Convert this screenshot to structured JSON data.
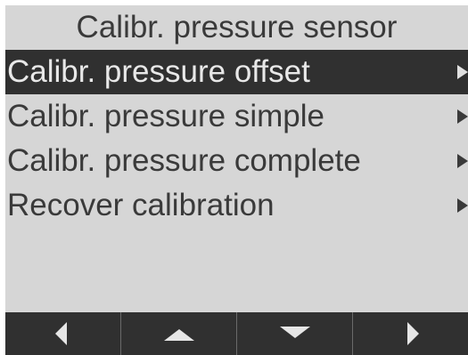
{
  "screen": {
    "title": "Calibr. pressure sensor"
  },
  "menu": {
    "items": [
      {
        "label": "Calibr. pressure offset",
        "selected": true,
        "icon": "submenu-arrow-icon"
      },
      {
        "label": "Calibr. pressure simple",
        "selected": false,
        "icon": "submenu-arrow-icon"
      },
      {
        "label": "Calibr. pressure complete",
        "selected": false,
        "icon": "submenu-arrow-icon"
      },
      {
        "label": "Recover calibration",
        "selected": false,
        "icon": "submenu-arrow-icon"
      }
    ]
  },
  "softkeys": [
    {
      "icon": "arrow-left-icon"
    },
    {
      "icon": "arrow-up-icon"
    },
    {
      "icon": "arrow-down-icon"
    },
    {
      "icon": "arrow-right-icon"
    }
  ],
  "colors": {
    "background": "#d6d6d6",
    "highlight": "#303030",
    "text": "#3a3a3a",
    "highlight_text": "#e8e8e8"
  }
}
